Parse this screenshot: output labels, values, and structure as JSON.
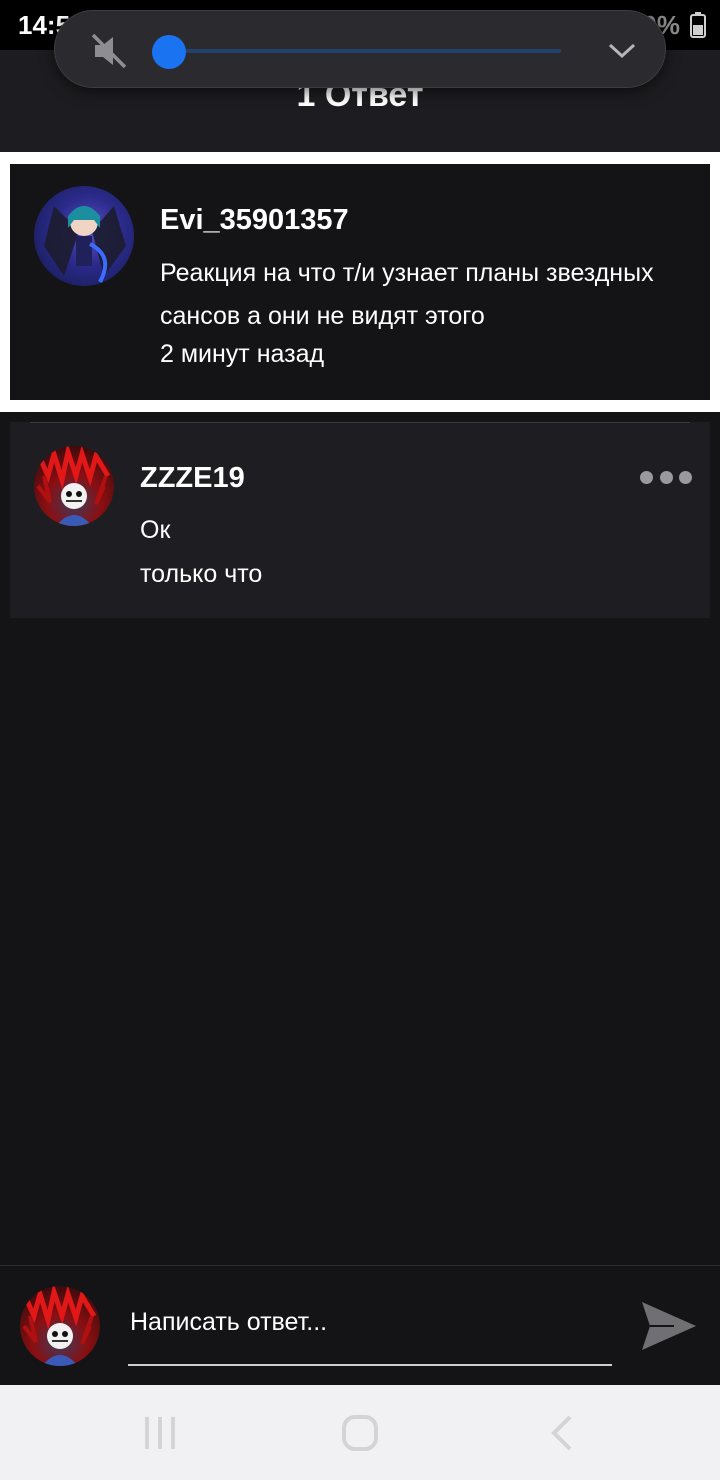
{
  "status_bar": {
    "time": "14:51",
    "battery": "50%",
    "icons": [
      "gmail-icon",
      "app-notification-icon",
      "mute-icon",
      "wifi-icon",
      "signal-icon",
      "battery-icon"
    ]
  },
  "volume_overlay": {
    "level": 0,
    "muted": true,
    "accent_color": "#1a74f2"
  },
  "header": {
    "title": "1 Ответ"
  },
  "parent_comment": {
    "author": "Evi_35901357",
    "text": "Реакция на что т/и узнает планы звездных сансов а они не видят этого",
    "time": "2 минут назад"
  },
  "reply": {
    "author": "ZZZE19",
    "text": "Ок",
    "time": "только что"
  },
  "composer": {
    "placeholder": "Написать ответ..."
  },
  "nav_bar": {
    "items": [
      "recent-apps-icon",
      "home-icon",
      "back-icon"
    ]
  }
}
